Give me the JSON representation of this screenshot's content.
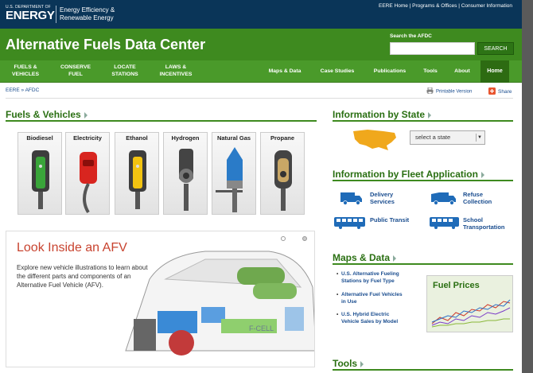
{
  "header": {
    "agency_small": "U.S. DEPARTMENT OF",
    "agency_big": "ENERGY",
    "office_line1": "Energy Efficiency &",
    "office_line2": "Renewable Energy",
    "top_links": "EERE Home | Programs & Offices | Consumer Information"
  },
  "title_bar": {
    "site_title": "Alternative Fuels Data Center",
    "search_label": "Search the AFDC",
    "search_value": "",
    "search_button": "SEARCH"
  },
  "nav": {
    "items": [
      {
        "line1": "FUELS &",
        "line2": "VEHICLES"
      },
      {
        "line1": "CONSERVE",
        "line2": "FUEL"
      },
      {
        "line1": "LOCATE",
        "line2": "STATIONS"
      },
      {
        "line1": "LAWS &",
        "line2": "INCENTIVES"
      },
      {
        "line1": "Maps & Data",
        "line2": ""
      },
      {
        "line1": "Case Studies",
        "line2": ""
      },
      {
        "line1": "Publications",
        "line2": ""
      },
      {
        "line1": "Tools",
        "line2": ""
      },
      {
        "line1": "About",
        "line2": ""
      }
    ],
    "home": "Home"
  },
  "breadcrumb": "EERE » AFDC",
  "printable": "Printable Version",
  "share": "Share",
  "fuels_section": {
    "title": "Fuels & Vehicles",
    "fuels": [
      "Biodiesel",
      "Electricity",
      "Ethanol",
      "Hydrogen",
      "Natural Gas",
      "Propane"
    ]
  },
  "afv_promo": {
    "title": "Look Inside an AFV",
    "description": "Explore new vehicle illustrations to learn about the different parts and components of an Alternative Fuel Vehicle (AFV).",
    "car_badge": "F-CELL"
  },
  "state_section": {
    "title": "Information by State",
    "select_value": "select a state"
  },
  "fleet_section": {
    "title": "Information by Fleet Application",
    "items": [
      {
        "line1": "Delivery",
        "line2": "Services"
      },
      {
        "line1": "Refuse",
        "line2": "Collection"
      },
      {
        "line1": "Public Transit",
        "line2": ""
      },
      {
        "line1": "School",
        "line2": "Transportation"
      }
    ]
  },
  "maps_section": {
    "title": "Maps & Data",
    "items": [
      {
        "line1": "U.S. Alternative Fueling",
        "line2": "Stations by Fuel Type"
      },
      {
        "line1": "Alternative Fuel Vehicles",
        "line2": "in Use"
      },
      {
        "line1": "U.S. Hybrid Electric",
        "line2": "Vehicle Sales by Model"
      }
    ],
    "fuel_prices_title": "Fuel Prices"
  },
  "tools_section": {
    "title": "Tools"
  },
  "side_url": "www.afdc.energy.gov",
  "colors": {
    "header_navy": "#0a3558",
    "brand_green": "#3e8a1f",
    "link_blue": "#1a4d8f",
    "promo_red": "#c8432f",
    "map_orange": "#f0a81c"
  }
}
